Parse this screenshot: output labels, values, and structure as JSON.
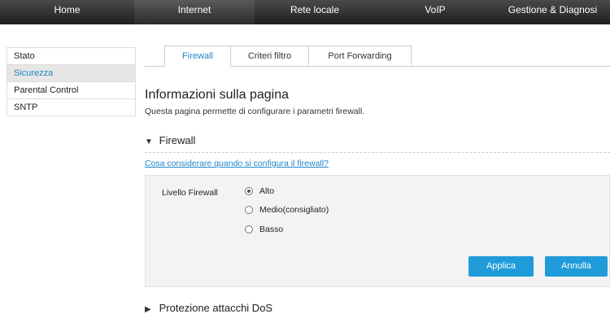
{
  "topnav": {
    "items": [
      "Home",
      "Internet",
      "Rete locale",
      "VoIP",
      "Gestione & Diagnosi"
    ]
  },
  "sidebar": {
    "items": [
      "Stato",
      "Sicurezza",
      "Parental Control",
      "SNTP"
    ]
  },
  "tabs": [
    "Firewall",
    "Criteri filtro",
    "Port Forwarding"
  ],
  "page": {
    "title": "Informazioni sulla pagina",
    "description": "Questa pagina permette di configurare i parametri firewall."
  },
  "firewall_section": {
    "title": "Firewall",
    "help_link": "Cosa considerare quando si configura il firewall?",
    "level_label": "Livello Firewall",
    "options": [
      "Alto",
      "Medio(consigliato)",
      "Basso"
    ],
    "selected": "Alto",
    "apply_label": "Applica",
    "cancel_label": "Annulla"
  },
  "dos_section": {
    "title": "Protezione attacchi DoS"
  },
  "colors": {
    "accent": "#1f87c9",
    "button": "#1f9bd9",
    "nav_bg": "#2a2a2a"
  }
}
